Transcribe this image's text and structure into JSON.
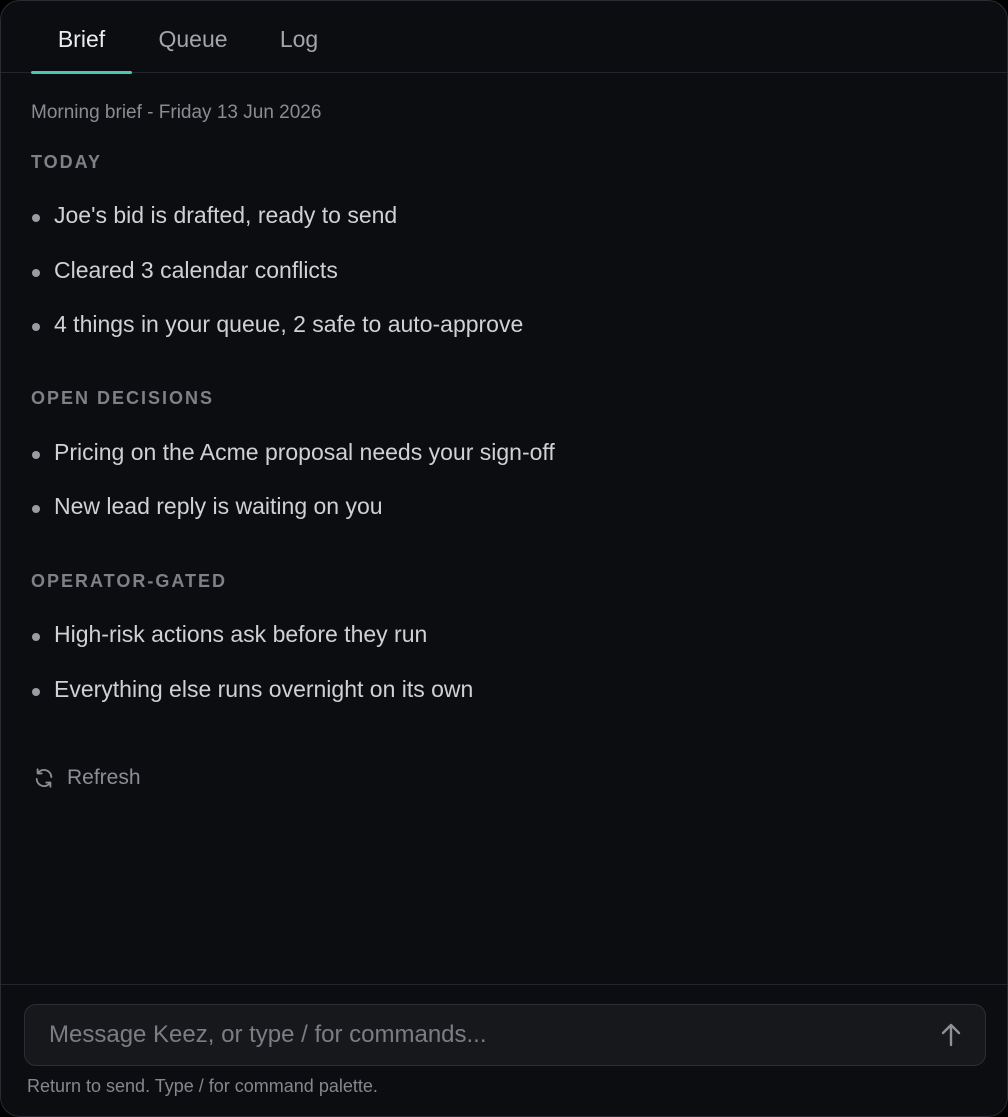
{
  "tabs": [
    {
      "label": "Brief",
      "active": true
    },
    {
      "label": "Queue",
      "active": false
    },
    {
      "label": "Log",
      "active": false
    }
  ],
  "brief": {
    "subtitle": "Morning brief - Friday 13 Jun 2026",
    "sections": [
      {
        "title": "TODAY",
        "items": [
          "Joe's bid is drafted, ready to send",
          "Cleared 3 calendar conflicts",
          "4 things in your queue, 2 safe to auto-approve"
        ]
      },
      {
        "title": "OPEN DECISIONS",
        "items": [
          "Pricing on the Acme proposal needs your sign-off",
          "New lead reply is waiting on you"
        ]
      },
      {
        "title": "OPERATOR-GATED",
        "items": [
          "High-risk actions ask before they run",
          "Everything else runs overnight on its own"
        ]
      }
    ],
    "refresh_label": "Refresh",
    "refresh_icon": "refresh-icon"
  },
  "composer": {
    "placeholder": "Message Keez, or type / for commands...",
    "value": "",
    "send_icon": "arrow-up-icon",
    "hint": "Return to send. Type / for command palette."
  },
  "colors": {
    "accent": "#45c9b6",
    "background": "#0c0d11",
    "input_background": "#17181c"
  }
}
